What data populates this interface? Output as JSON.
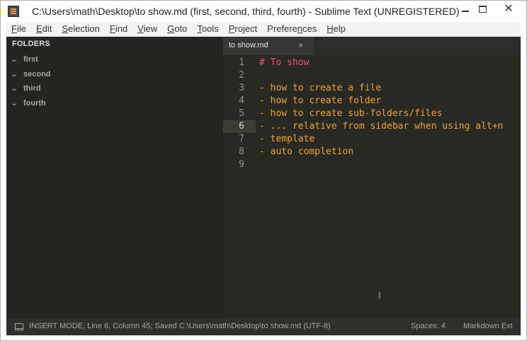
{
  "window": {
    "title": "C:\\Users\\math\\Desktop\\to show.md (first, second, third, fourth) - Sublime Text (UNREGISTERED)"
  },
  "menu": [
    {
      "label": "File",
      "mnemonic": "F",
      "rest": "ile"
    },
    {
      "label": "Edit",
      "mnemonic": "E",
      "rest": "dit"
    },
    {
      "label": "Selection",
      "mnemonic": "S",
      "rest": "election"
    },
    {
      "label": "Find",
      "mnemonic": "F",
      "rest": "ind"
    },
    {
      "label": "View",
      "mnemonic": "V",
      "rest": "iew"
    },
    {
      "label": "Goto",
      "mnemonic": "G",
      "rest": "oto"
    },
    {
      "label": "Tools",
      "mnemonic": "T",
      "rest": "ools"
    },
    {
      "label": "Project",
      "mnemonic": "P",
      "rest": "roject"
    },
    {
      "label": "Preferences",
      "mnemonic": "n",
      "pre": "Prefere",
      "rest": "ces"
    },
    {
      "label": "Help",
      "mnemonic": "H",
      "rest": "elp"
    }
  ],
  "sidebar": {
    "header": "FOLDERS",
    "folders": [
      "first",
      "second",
      "third",
      "fourth"
    ]
  },
  "tabs": [
    {
      "label": "to show.md",
      "close": "×"
    }
  ],
  "editor": {
    "active_line": 6,
    "lines": [
      {
        "num": "1",
        "text": "# To show"
      },
      {
        "num": "2",
        "text": ""
      },
      {
        "num": "3",
        "text": "- how to create a file"
      },
      {
        "num": "4",
        "text": "- how to create folder"
      },
      {
        "num": "5",
        "text": "- how to create sub-folders/files"
      },
      {
        "num": "6",
        "text": "- ... relative from sidebar when using alt+n"
      },
      {
        "num": "7",
        "text": "- template"
      },
      {
        "num": "8",
        "text": "- auto completion"
      },
      {
        "num": "9",
        "text": ""
      }
    ]
  },
  "status": {
    "message": "INSERT MODE, Line 6, Column 45; Saved C:\\Users\\math\\Desktop\\to show.md (UTF-8)",
    "indentation": "Spaces: 4",
    "syntax": "Markdown Ext"
  },
  "colors": {
    "heading": "#f2516e",
    "list_text": "#f0a13a",
    "editor_bg": "#282923",
    "sidebar_bg": "#232521"
  }
}
